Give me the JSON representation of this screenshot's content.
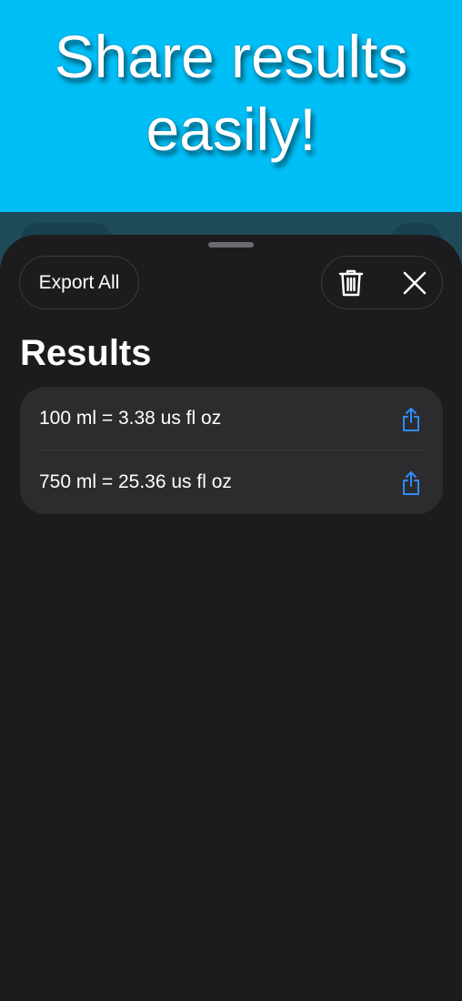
{
  "promo": {
    "line1": "Share results",
    "line2": "easily!"
  },
  "toolbar": {
    "export_label": "Export All",
    "trash_icon": "trash-icon",
    "close_icon": "close-icon"
  },
  "results": {
    "title": "Results",
    "items": [
      {
        "text": "100 ml = 3.38 us fl oz",
        "icon": "share-icon"
      },
      {
        "text": "750 ml = 25.36 us fl oz",
        "icon": "share-icon"
      }
    ]
  },
  "colors": {
    "banner": "#00bff7",
    "sheet_background": "#1c1c1e",
    "card_background": "#2c2c2e",
    "accent": "#2f8cff"
  }
}
